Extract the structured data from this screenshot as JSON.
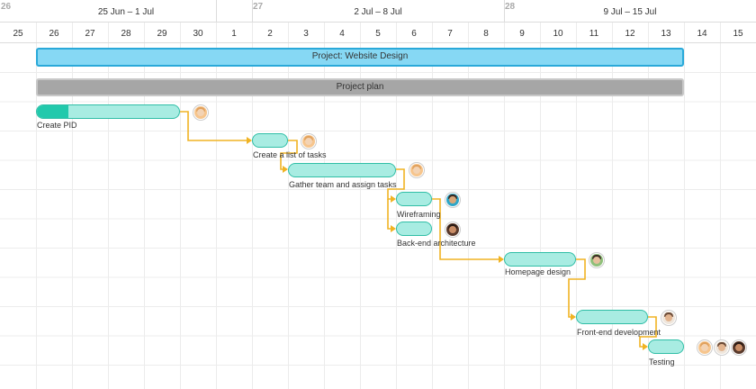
{
  "timeline": {
    "weeks": [
      {
        "number": "26",
        "label": ""
      },
      {
        "number": "",
        "label": "25 Jun – 1 Jul"
      },
      {
        "number": "27",
        "label": "2 Jul – 8 Jul"
      },
      {
        "number": "28",
        "label": "9 Jul – 15 Jul"
      }
    ],
    "days": [
      "25",
      "26",
      "27",
      "28",
      "29",
      "30",
      "1",
      "2",
      "3",
      "4",
      "5",
      "6",
      "7",
      "8",
      "9",
      "10",
      "11",
      "12",
      "13",
      "14",
      "15"
    ]
  },
  "project": {
    "name": "Project: Website Design"
  },
  "plan": {
    "name": "Project plan"
  },
  "tasks": [
    {
      "name": "Create PID",
      "avatar": "assignee-avatar",
      "progress": 0.22
    },
    {
      "name": "Create a list of tasks",
      "avatar": "assignee-avatar",
      "progress": 0
    },
    {
      "name": "Gather team and assign tasks",
      "avatar": "assignee-avatar",
      "progress": 0
    },
    {
      "name": "Wireframing",
      "avatar": "assignee-avatar",
      "progress": 0
    },
    {
      "name": "Back-end architecture",
      "avatar": "assignee-avatar",
      "progress": 0
    },
    {
      "name": "Homepage design",
      "avatar": "assignee-avatar",
      "progress": 0
    },
    {
      "name": "Front-end development",
      "avatar": "assignee-avatar",
      "progress": 0
    },
    {
      "name": "Testing",
      "avatar": "assignee-avatar",
      "progress": 0
    }
  ],
  "colors": {
    "grid": "#ececec",
    "header_border": "#dcdcdc",
    "project_fill": "#86d8f4",
    "project_border": "#2aa9d9",
    "plan_fill": "#a6a6a6",
    "task_fill": "#a8ece2",
    "task_border": "#2fbea6",
    "progress": "#22c9ac",
    "dependency": "#f0b323"
  }
}
